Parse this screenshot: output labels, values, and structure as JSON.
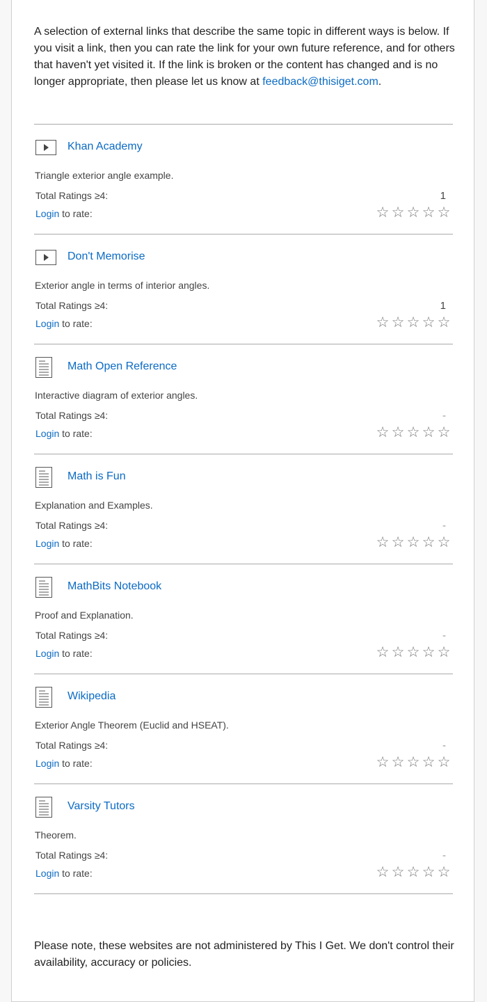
{
  "intro": {
    "text": "A selection of external links that describe the same topic in different ways is below. If you visit a link, then you can rate the link for your own future reference, and for others that haven't yet visited it. If the link is broken or the content has changed and is no longer appropriate, then please let us know at ",
    "email": "feedback@thisiget.com",
    "end": "."
  },
  "labels": {
    "total_ratings": "Total Ratings ≥4:",
    "login": "Login",
    "to_rate": " to rate:"
  },
  "star_glyph": "☆",
  "items": [
    {
      "type": "video",
      "icon": "video-play-icon",
      "title": "Khan Academy",
      "description": "Triangle exterior angle example.",
      "total": "1",
      "stars": 0
    },
    {
      "type": "video",
      "icon": "video-play-icon",
      "title": "Don't Memorise",
      "description": "Exterior angle in terms of interior angles.",
      "total": "1",
      "stars": 0
    },
    {
      "type": "document",
      "icon": "document-icon",
      "title": "Math Open Reference",
      "description": "Interactive diagram of exterior angles.",
      "total": "-",
      "stars": 0
    },
    {
      "type": "document",
      "icon": "document-icon",
      "title": "Math is Fun",
      "description": "Explanation and Examples.",
      "total": "-",
      "stars": 0
    },
    {
      "type": "document",
      "icon": "document-icon",
      "title": "MathBits Notebook",
      "description": "Proof and Explanation.",
      "total": "-",
      "stars": 0
    },
    {
      "type": "document",
      "icon": "document-icon",
      "title": "Wikipedia",
      "description": "Exterior Angle Theorem (Euclid and HSEAT).",
      "total": "-",
      "stars": 0
    },
    {
      "type": "document",
      "icon": "document-icon",
      "title": "Varsity Tutors",
      "description": "Theorem.",
      "total": "-",
      "stars": 0
    }
  ],
  "note": "Please note, these websites are not administered by This I Get. We don't control their availability, accuracy or policies."
}
